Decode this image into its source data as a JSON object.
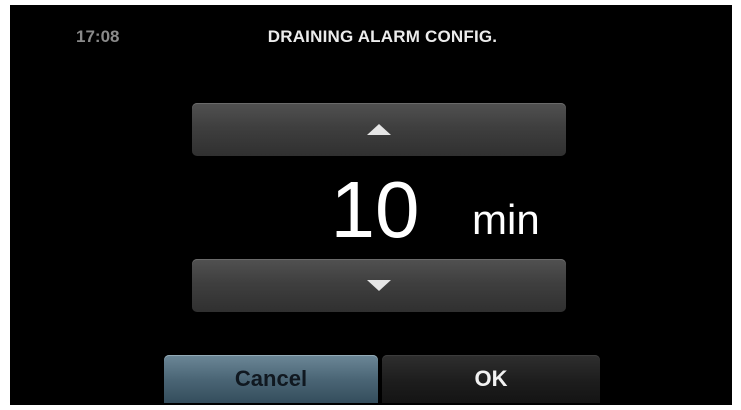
{
  "header": {
    "time": "17:08",
    "title": "DRAINING ALARM CONFIG."
  },
  "setting": {
    "value": "10",
    "unit": "min"
  },
  "controls": {
    "increase_icon": "triangle-up-icon",
    "decrease_icon": "triangle-down-icon"
  },
  "buttons": {
    "cancel_label": "Cancel",
    "ok_label": "OK"
  },
  "colors": {
    "background": "#000000",
    "cancel_accent": "#4b6676",
    "stepper": "#3f3f3f"
  }
}
